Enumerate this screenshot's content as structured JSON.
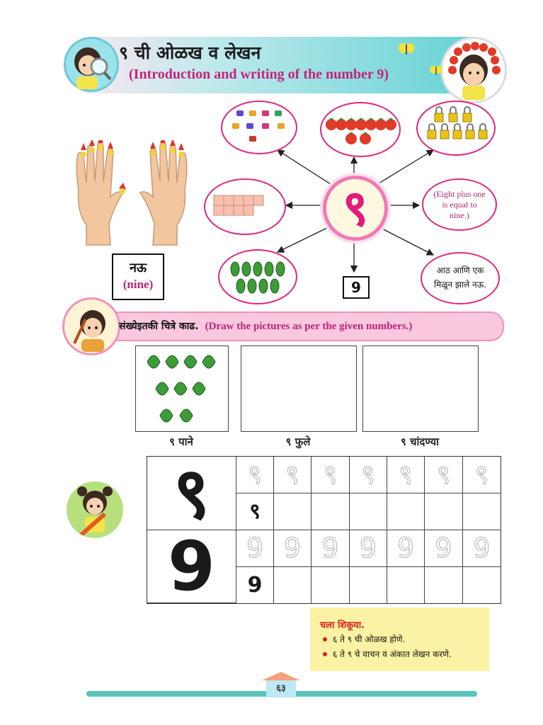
{
  "header": {
    "title_mr": "९ ची ओळख व लेखन",
    "title_en": "(Introduction and writing of the number 9)"
  },
  "hub": {
    "digit": "९",
    "addition_text_en": [
      "(Eight plus one",
      "is equal to",
      "nine.)"
    ],
    "addition_text_mr": [
      "आठ आणि एक",
      "मिळून झाले नऊ."
    ],
    "numeral": "9"
  },
  "word_box": {
    "word_mr": "नऊ",
    "word_en": "(nine)"
  },
  "instruction": {
    "text_mr": "संख्येइतकी चित्रे काढ.",
    "text_en": "(Draw the pictures as per the given numbers.)"
  },
  "draw_boxes": [
    {
      "label": "९ पाने"
    },
    {
      "label": "९ फुले"
    },
    {
      "label": "९ चांदण्या"
    }
  ],
  "tracing": {
    "devanagari_digit": "९",
    "roman_digit": "9"
  },
  "learning": {
    "title": "चला शिकूया.",
    "items": [
      "६ ते ९ ची ओळख होणे.",
      "६ ते ९ चे वाचन व अंकात लेखन करणे."
    ]
  },
  "footer": {
    "page_number": "६३"
  },
  "colors": {
    "accent_pink": "#e01b7c",
    "banner_teal": "#5ed0d2",
    "leaf_green": "#3f9a3a",
    "tomato_red": "#e23a2a",
    "lock_yellow": "#e7c21b"
  }
}
